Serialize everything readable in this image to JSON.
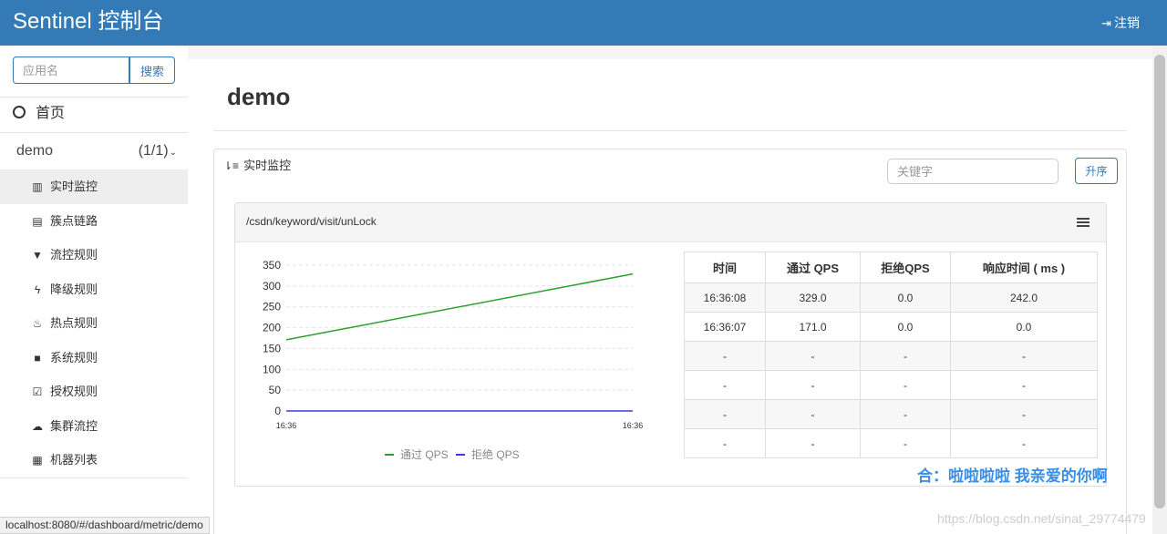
{
  "header": {
    "title": "Sentinel 控制台",
    "logout_label": "注销"
  },
  "sidebar": {
    "search_placeholder": "应用名",
    "search_button": "搜索",
    "home_label": "首页",
    "app": {
      "name": "demo",
      "count": "(1/1)"
    },
    "menu": [
      {
        "label": "实时监控",
        "icon": "bar-chart-icon",
        "glyph": "▥",
        "active": true
      },
      {
        "label": "簇点链路",
        "icon": "list-icon",
        "glyph": "▤",
        "active": false
      },
      {
        "label": "流控规则",
        "icon": "filter-icon",
        "glyph": "▼",
        "active": false
      },
      {
        "label": "降级规则",
        "icon": "flash-icon",
        "glyph": "ϟ",
        "active": false
      },
      {
        "label": "热点规则",
        "icon": "fire-icon",
        "glyph": "♨",
        "active": false
      },
      {
        "label": "系统规则",
        "icon": "lock-icon",
        "glyph": "■",
        "active": false
      },
      {
        "label": "授权规则",
        "icon": "check-icon",
        "glyph": "☑",
        "active": false
      },
      {
        "label": "集群流控",
        "icon": "cloud-icon",
        "glyph": "☁",
        "active": false
      },
      {
        "label": "机器列表",
        "icon": "th-list-icon",
        "glyph": "▦",
        "active": false
      }
    ]
  },
  "status_url": "localhost:8080/#/dashboard/metric/demo",
  "main": {
    "page_title": "demo",
    "panel_title": "实时监控",
    "keyword_placeholder": "关键字",
    "sort_button": "升序",
    "resource": "/csdn/keyword/visit/unLock",
    "table": {
      "headers": [
        "时间",
        "通过 QPS",
        "拒绝QPS",
        "响应时间 ( ms )"
      ],
      "rows": [
        [
          "16:36:08",
          "329.0",
          "0.0",
          "242.0"
        ],
        [
          "16:36:07",
          "171.0",
          "0.0",
          "0.0"
        ],
        [
          "-",
          "-",
          "-",
          "-"
        ],
        [
          "-",
          "-",
          "-",
          "-"
        ],
        [
          "-",
          "-",
          "-",
          "-"
        ],
        [
          "-",
          "-",
          "-",
          "-"
        ]
      ]
    }
  },
  "chart_data": {
    "type": "line",
    "x": [
      "16:36:07",
      "16:36:08"
    ],
    "x_tick_labels": [
      "16:36",
      "16:36"
    ],
    "series": [
      {
        "name": "通过 QPS",
        "values": [
          171,
          329
        ],
        "color": "#2ca02c"
      },
      {
        "name": "拒绝 QPS",
        "values": [
          0,
          0
        ],
        "color": "#3b3bdc"
      }
    ],
    "ylim": [
      0,
      350
    ],
    "yticks": [
      0,
      50,
      100,
      150,
      200,
      250,
      300,
      350
    ],
    "grid": true,
    "legend": "bottom"
  },
  "watermark": {
    "line1": "合：啦啦啦啦 我亲爱的你啊",
    "line2": "https://blog.csdn.net/sinat_29774479"
  }
}
